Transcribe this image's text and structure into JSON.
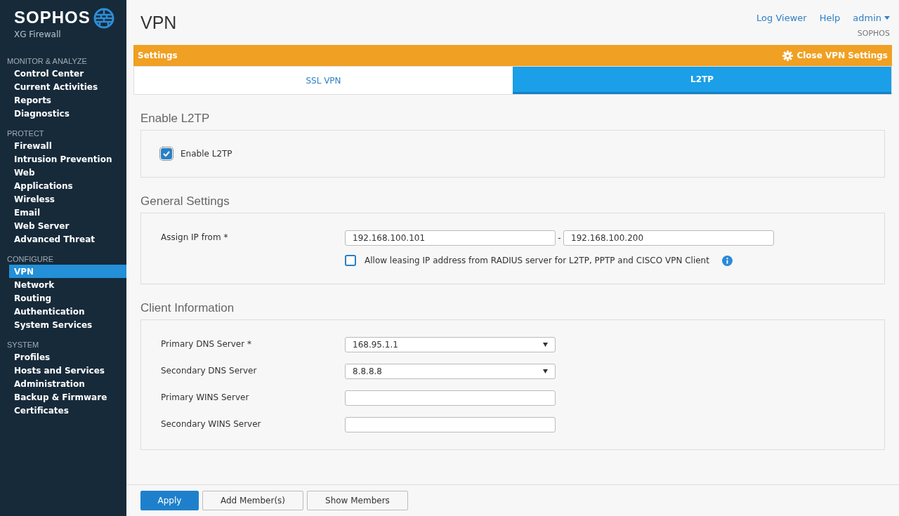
{
  "brand": {
    "name": "SOPHOS",
    "product": "XG Firewall"
  },
  "sidebar": {
    "groups": [
      {
        "heading": "MONITOR & ANALYZE",
        "items": [
          {
            "label": "Control Center",
            "selected": false
          },
          {
            "label": "Current Activities",
            "selected": false
          },
          {
            "label": "Reports",
            "selected": false
          },
          {
            "label": "Diagnostics",
            "selected": false
          }
        ]
      },
      {
        "heading": "PROTECT",
        "items": [
          {
            "label": "Firewall",
            "selected": false
          },
          {
            "label": "Intrusion Prevention",
            "selected": false
          },
          {
            "label": "Web",
            "selected": false
          },
          {
            "label": "Applications",
            "selected": false
          },
          {
            "label": "Wireless",
            "selected": false
          },
          {
            "label": "Email",
            "selected": false
          },
          {
            "label": "Web Server",
            "selected": false
          },
          {
            "label": "Advanced Threat",
            "selected": false
          }
        ]
      },
      {
        "heading": "CONFIGURE",
        "items": [
          {
            "label": "VPN",
            "selected": true
          },
          {
            "label": "Network",
            "selected": false
          },
          {
            "label": "Routing",
            "selected": false
          },
          {
            "label": "Authentication",
            "selected": false
          },
          {
            "label": "System Services",
            "selected": false
          }
        ]
      },
      {
        "heading": "SYSTEM",
        "items": [
          {
            "label": "Profiles",
            "selected": false
          },
          {
            "label": "Hosts and Services",
            "selected": false
          },
          {
            "label": "Administration",
            "selected": false
          },
          {
            "label": "Backup & Firmware",
            "selected": false
          },
          {
            "label": "Certificates",
            "selected": false
          }
        ]
      }
    ]
  },
  "page_title": "VPN",
  "top_links": [
    "Log Viewer",
    "Help"
  ],
  "user": {
    "name": "admin",
    "org": "SOPHOS"
  },
  "settings_bar": {
    "title": "Settings",
    "action": "Close VPN Settings"
  },
  "tabs": [
    {
      "label": "SSL VPN",
      "selected": false
    },
    {
      "label": "L2TP",
      "selected": true
    }
  ],
  "sections": [
    {
      "title": "Enable L2TP",
      "rows": [
        {
          "kind": "checkbox",
          "label": "Enable L2TP",
          "checked": true,
          "indented": false,
          "has_info": false
        }
      ]
    },
    {
      "title": "General Settings",
      "rows": [
        {
          "kind": "range",
          "label": "Assign IP from *",
          "from": "192.168.100.101",
          "separator": "-",
          "to": "192.168.100.200"
        },
        {
          "kind": "checkbox",
          "label": "Allow leasing IP address from RADIUS server for L2TP, PPTP and CISCO VPN Client",
          "checked": false,
          "indented": true,
          "has_info": true
        }
      ]
    },
    {
      "title": "Client Information",
      "rows": [
        {
          "kind": "select",
          "label": "Primary DNS Server *",
          "value": "168.95.1.1"
        },
        {
          "kind": "select",
          "label": "Secondary DNS Server",
          "value": "8.8.8.8"
        },
        {
          "kind": "text",
          "label": "Primary WINS Server"
        },
        {
          "kind": "text",
          "label": "Secondary WINS Server"
        }
      ]
    }
  ],
  "buttons": [
    {
      "label": "Apply",
      "kind": "primary"
    },
    {
      "label": "Add Member(s)",
      "kind": "secondary"
    },
    {
      "label": "Show Members",
      "kind": "secondary"
    }
  ]
}
